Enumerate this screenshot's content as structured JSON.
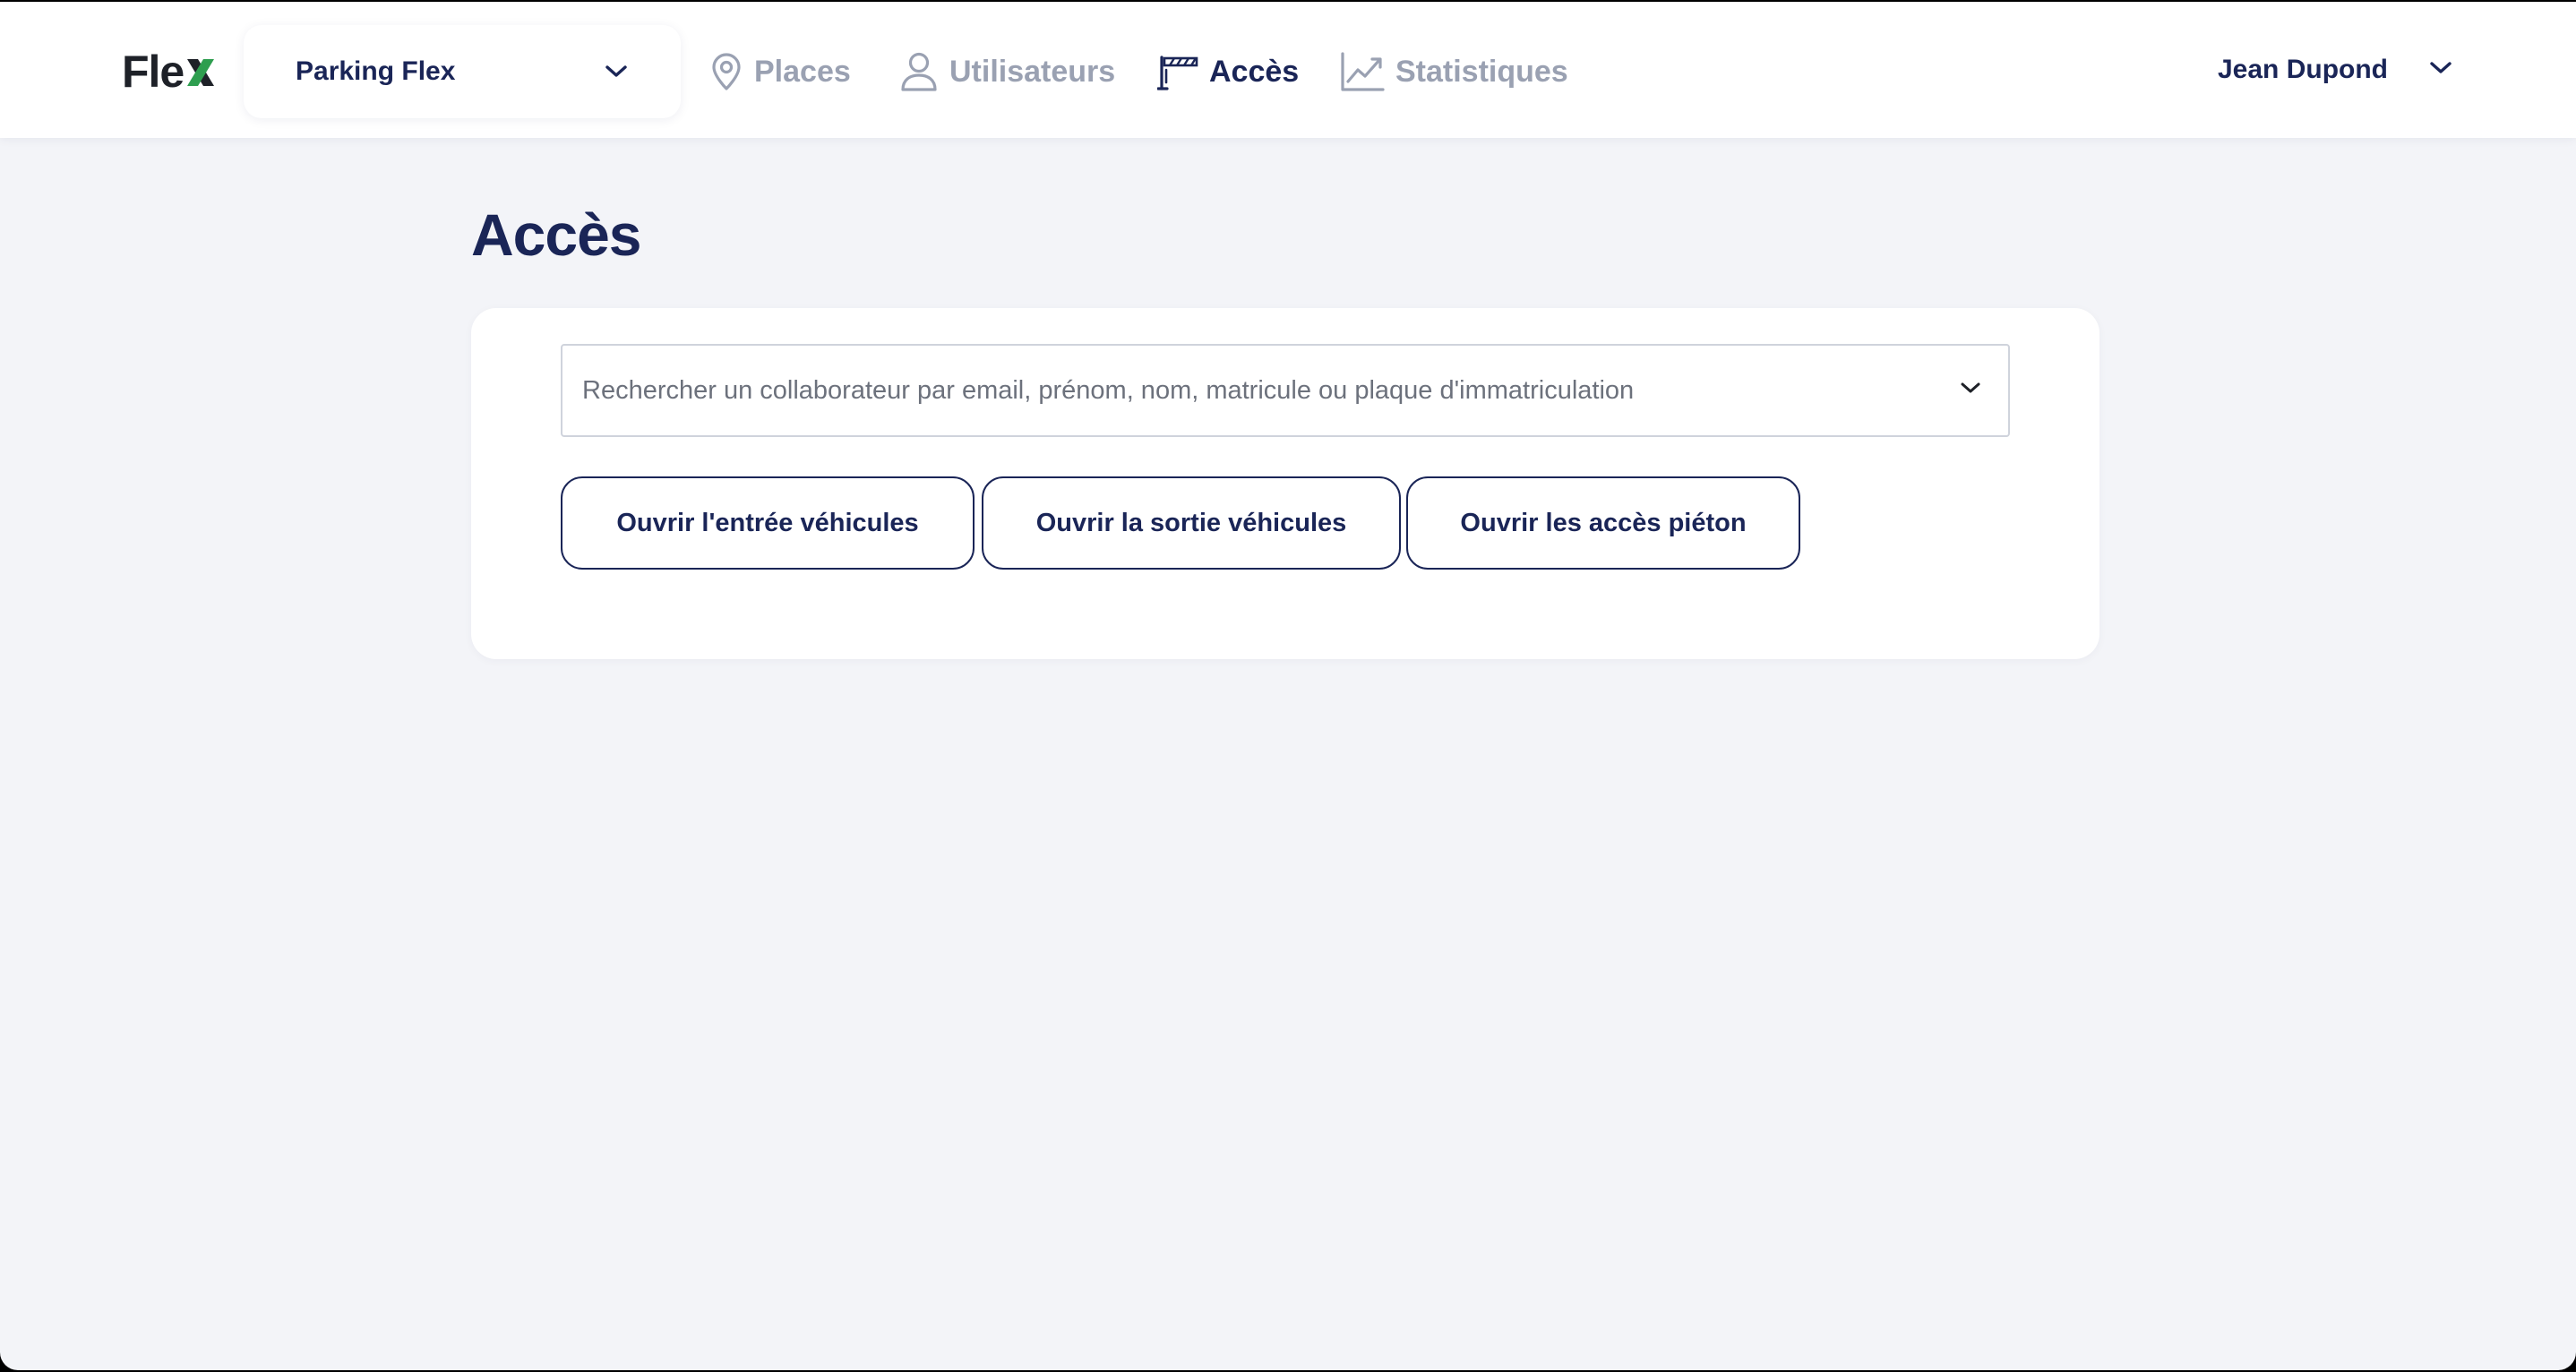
{
  "header": {
    "logo": {
      "text": "Fle",
      "accent_letter": "x"
    },
    "site_selector": {
      "value": "Parking Flex",
      "icon": "chevron-down-icon"
    },
    "nav": [
      {
        "label": "Places",
        "icon": "map-pin-icon",
        "active": false
      },
      {
        "label": "Utilisateurs",
        "icon": "user-icon",
        "active": false
      },
      {
        "label": "Accès",
        "icon": "barrier-gate-icon",
        "active": true
      },
      {
        "label": "Statistiques",
        "icon": "trend-chart-icon",
        "active": false
      }
    ],
    "user": {
      "name": "Jean Dupond",
      "icon": "chevron-down-icon"
    }
  },
  "main": {
    "title": "Accès",
    "search": {
      "placeholder": "Rechercher un collaborateur par email, prénom, nom, matricule ou plaque d'immatriculation",
      "value": ""
    },
    "actions": {
      "open_entry": "Ouvrir l'entrée véhicules",
      "open_exit": "Ouvrir la sortie véhicules",
      "open_pedestrian": "Ouvrir les accès piéton"
    }
  },
  "colors": {
    "navy": "#1a2557",
    "muted_nav": "#9aa1b2",
    "logo_green": "#2e9e4f",
    "background": "#f3f4f8"
  }
}
